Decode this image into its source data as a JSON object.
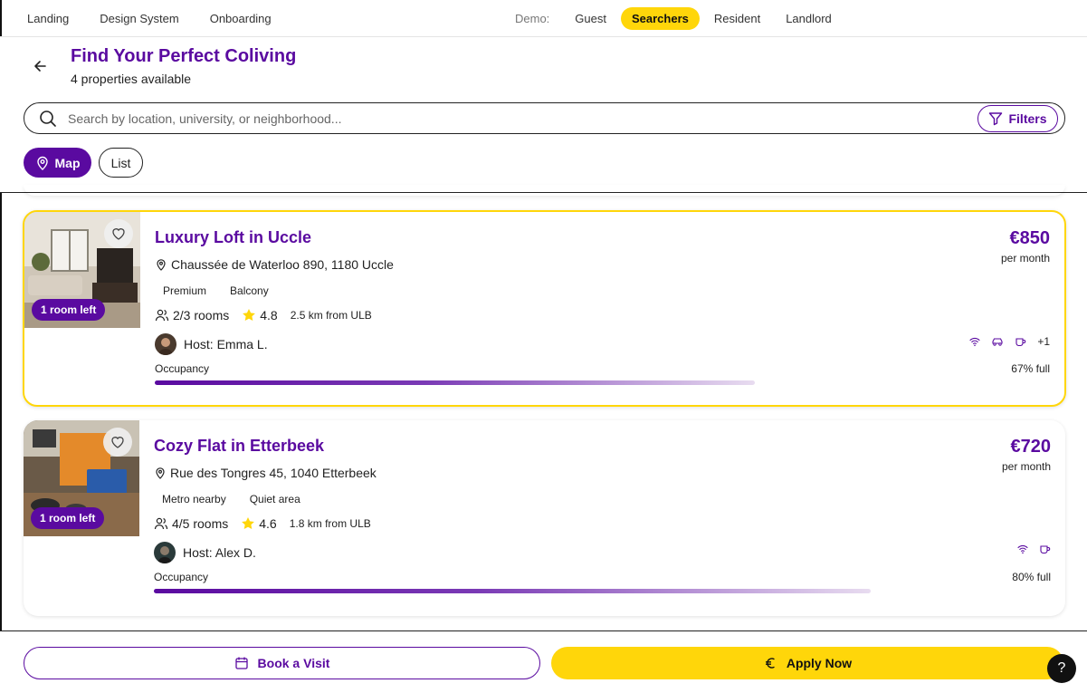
{
  "topnav": {
    "links": [
      "Landing",
      "Design System",
      "Onboarding"
    ],
    "demo_label": "Demo:",
    "demo_items": [
      "Guest",
      "Searchers",
      "Resident",
      "Landlord"
    ],
    "demo_active": "Searchers"
  },
  "header": {
    "title": "Find Your Perfect Coliving",
    "subtitle": "4 properties available",
    "search_placeholder": "Search by location, university, or neighborhood...",
    "filters_label": "Filters",
    "map_label": "Map",
    "list_label": "List"
  },
  "cards": [
    {
      "title": "Luxury Loft in Uccle",
      "address": "Chaussée de Waterloo 890, 1180 Uccle",
      "tags": [
        "Premium",
        "Balcony"
      ],
      "rooms": "2/3 rooms",
      "rating": "4.8",
      "distance": "2.5 km from ULB",
      "host": "Host: Emma L.",
      "badge": "1 room left",
      "price": "€850",
      "per": "per month",
      "amenities": [
        "wifi-icon",
        "car-icon",
        "coffee-icon"
      ],
      "more": "+1",
      "occupancy_label": "Occupancy",
      "occupancy": 0.67,
      "full_text": "67% full",
      "highlight": true
    },
    {
      "title": "Cozy Flat in Etterbeek",
      "address": "Rue des Tongres 45, 1040 Etterbeek",
      "tags": [
        "Metro nearby",
        "Quiet area"
      ],
      "rooms": "4/5 rooms",
      "rating": "4.6",
      "distance": "1.8 km from ULB",
      "host": "Host: Alex D.",
      "badge": "1 room left",
      "price": "€720",
      "per": "per month",
      "amenities": [
        "wifi-icon",
        "coffee-icon"
      ],
      "more": "",
      "occupancy_label": "Occupancy",
      "occupancy": 0.8,
      "full_text": "80% full",
      "highlight": false
    }
  ],
  "bottom": {
    "visit_label": "Book a Visit",
    "apply_label": "Apply Now",
    "help_label": "?"
  },
  "colors": {
    "brand_purple": "#5a0aa0",
    "accent_yellow": "#ffd60a"
  }
}
